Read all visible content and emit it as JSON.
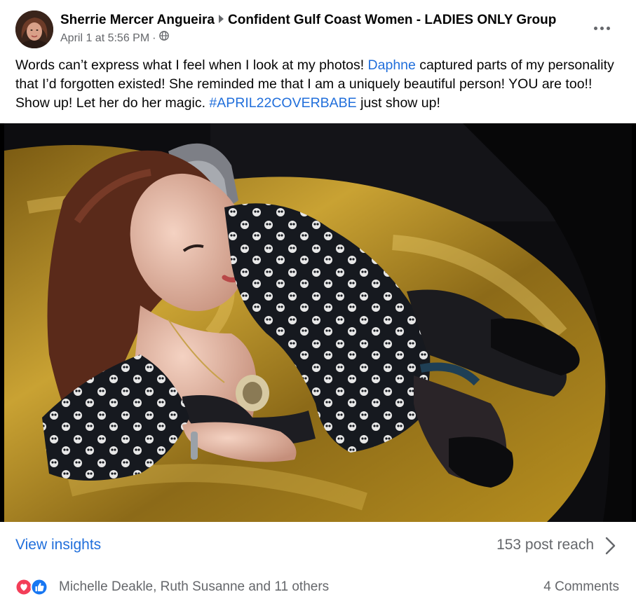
{
  "post": {
    "author": "Sherrie Mercer Angueira",
    "group": "Confident Gulf Coast Women - LADIES ONLY Group",
    "timestamp": "April 1 at 5:56 PM",
    "separator": "·",
    "audience_icon": "globe-icon",
    "more_icon": "more-options-icon",
    "text_parts": {
      "p1": "Words can’t express what I feel when I look at my photos! ",
      "mention": "Daphne",
      "p2": " captured parts of my personality that I’d forgotten existed! She reminded me that I am a uniquely beautiful person! YOU are too!! Show up! Let her do her magic. ",
      "hashtag": "#APRIL22COVERBABE",
      "p3": " just show up!"
    }
  },
  "insights": {
    "label": "View insights",
    "reach": "153 post reach",
    "chevron_icon": "chevron-right-icon"
  },
  "reactions": {
    "icons": [
      "love-reaction-icon",
      "like-reaction-icon"
    ],
    "names": "Michelle Deakle, Ruth Susanne and 11 others",
    "comments": "4 Comments"
  },
  "colors": {
    "link": "#216fdb",
    "secondary_text": "#65676b",
    "like_blue": "#1877f2",
    "love_red": "#f33e58"
  }
}
